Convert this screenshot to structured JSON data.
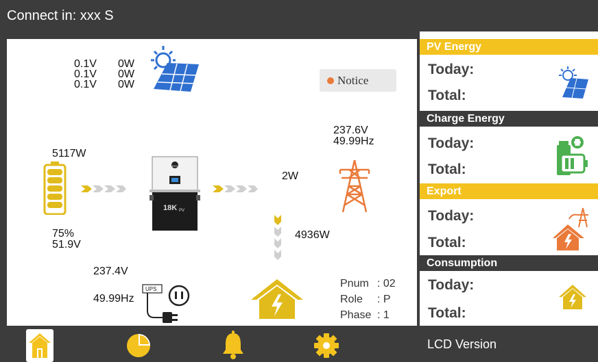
{
  "header": {
    "connect_text": "Connect in: xxx S"
  },
  "pv": {
    "lines": [
      {
        "v": "0.1V",
        "w": "0W"
      },
      {
        "v": "0.1V",
        "w": "0W"
      },
      {
        "v": "0.1V",
        "w": "0W"
      }
    ]
  },
  "notice": {
    "label": "Notice"
  },
  "battery": {
    "power": "5117W",
    "soc": "75%",
    "voltage": "51.9V"
  },
  "grid": {
    "voltage": "237.6V",
    "frequency": "49.99Hz",
    "power": "2W"
  },
  "load": {
    "power": "4936W"
  },
  "ups": {
    "voltage": "237.4V",
    "frequency": "49.99Hz",
    "badge": "UPS"
  },
  "inverter": {
    "model": "18K",
    "model_sub": "PV",
    "logo": "EG4"
  },
  "parallel": {
    "pnum_label": "Pnum",
    "pnum_value": ": 02",
    "role_label": "Role",
    "role_value": ": P",
    "phase_label": "Phase",
    "phase_value": ": 1"
  },
  "energy": {
    "pv": {
      "title": "PV Energy",
      "today": "Today:",
      "total": "Total:"
    },
    "charge": {
      "title": "Charge Energy",
      "today": "Today:",
      "total": "Total:"
    },
    "export": {
      "title": "Export",
      "today": "Today:",
      "total": "Total:"
    },
    "consumption": {
      "title": "Consumption",
      "today": "Today:",
      "total": "Total:"
    }
  },
  "footer": {
    "lcd_version": "LCD Version"
  },
  "colors": {
    "accent": "#f3c21e",
    "dark": "#3c3c3c",
    "orange": "#ea7a3a",
    "blue": "#2f6fd0",
    "green": "#4caf50"
  },
  "icons": [
    "sun-panel-icon",
    "battery-icon",
    "inverter-icon",
    "tower-icon",
    "house-icon",
    "ups-plug-icon",
    "home-nav-icon",
    "pie-chart-icon",
    "bell-icon",
    "gear-icon"
  ]
}
